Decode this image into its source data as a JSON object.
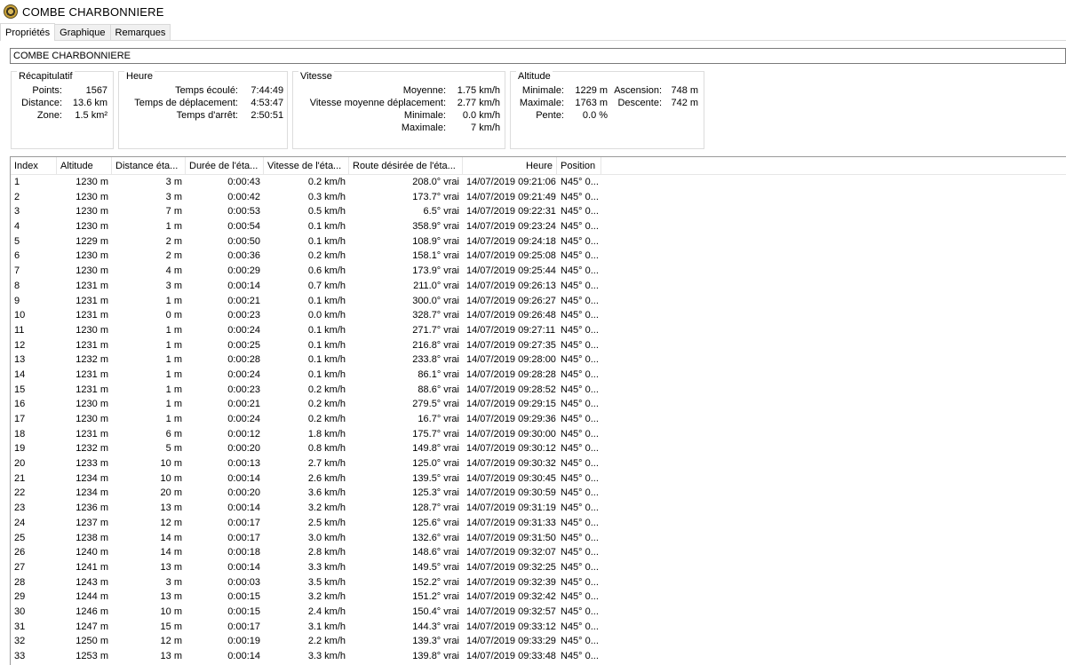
{
  "window": {
    "title": "COMBE  CHARBONNIERE",
    "icon": "app-logo-icon"
  },
  "tabs": [
    {
      "label": "Propriétés",
      "active": true
    },
    {
      "label": "Graphique",
      "active": false
    },
    {
      "label": "Remarques",
      "active": false
    }
  ],
  "name_field": {
    "value": "COMBE  CHARBONNIERE"
  },
  "recap": {
    "title": "Récapitulatif",
    "points_label": "Points:",
    "points_value": "1567",
    "distance_label": "Distance:",
    "distance_value": "13.6 km",
    "zone_label": "Zone:",
    "zone_value": "1.5 km²"
  },
  "heure": {
    "title": "Heure",
    "elapsed_label": "Temps écoulé:",
    "elapsed_value": "7:44:49",
    "moving_label": "Temps de déplacement:",
    "moving_value": "4:53:47",
    "stopped_label": "Temps d'arrêt:",
    "stopped_value": "2:50:51"
  },
  "vitesse": {
    "title": "Vitesse",
    "avg_label": "Moyenne:",
    "avg_value": "1.75 km/h",
    "moving_avg_label": "Vitesse moyenne déplacement:",
    "moving_avg_value": "2.77 km/h",
    "min_label": "Minimale:",
    "min_value": "0.0 km/h",
    "max_label": "Maximale:",
    "max_value": "7 km/h"
  },
  "altitude": {
    "title": "Altitude",
    "min_label": "Minimale:",
    "min_value": "1229 m",
    "max_label": "Maximale:",
    "max_value": "1763 m",
    "slope_label": "Pente:",
    "slope_value": "0.0 %",
    "ascent_label": "Ascension:",
    "ascent_value": "748 m",
    "descent_label": "Descente:",
    "descent_value": "742 m"
  },
  "table": {
    "columns": [
      "Index",
      "Altitude",
      "Distance éta...",
      "Durée de l'éta...",
      "Vitesse de l'éta...",
      "Route désirée de l'éta...",
      "Heure",
      "Position"
    ],
    "rows": [
      [
        "1",
        "1230 m",
        "3 m",
        "0:00:43",
        "0.2 km/h",
        "208.0° vrai",
        "14/07/2019 09:21:06",
        "N45° 0..."
      ],
      [
        "2",
        "1230 m",
        "3 m",
        "0:00:42",
        "0.3 km/h",
        "173.7° vrai",
        "14/07/2019 09:21:49",
        "N45° 0..."
      ],
      [
        "3",
        "1230 m",
        "7 m",
        "0:00:53",
        "0.5 km/h",
        "6.5° vrai",
        "14/07/2019 09:22:31",
        "N45° 0..."
      ],
      [
        "4",
        "1230 m",
        "1 m",
        "0:00:54",
        "0.1 km/h",
        "358.9° vrai",
        "14/07/2019 09:23:24",
        "N45° 0..."
      ],
      [
        "5",
        "1229 m",
        "2 m",
        "0:00:50",
        "0.1 km/h",
        "108.9° vrai",
        "14/07/2019 09:24:18",
        "N45° 0..."
      ],
      [
        "6",
        "1230 m",
        "2 m",
        "0:00:36",
        "0.2 km/h",
        "158.1° vrai",
        "14/07/2019 09:25:08",
        "N45° 0..."
      ],
      [
        "7",
        "1230 m",
        "4 m",
        "0:00:29",
        "0.6 km/h",
        "173.9° vrai",
        "14/07/2019 09:25:44",
        "N45° 0..."
      ],
      [
        "8",
        "1231 m",
        "3 m",
        "0:00:14",
        "0.7 km/h",
        "211.0° vrai",
        "14/07/2019 09:26:13",
        "N45° 0..."
      ],
      [
        "9",
        "1231 m",
        "1 m",
        "0:00:21",
        "0.1 km/h",
        "300.0° vrai",
        "14/07/2019 09:26:27",
        "N45° 0..."
      ],
      [
        "10",
        "1231 m",
        "0 m",
        "0:00:23",
        "0.0 km/h",
        "328.7° vrai",
        "14/07/2019 09:26:48",
        "N45° 0..."
      ],
      [
        "11",
        "1230 m",
        "1 m",
        "0:00:24",
        "0.1 km/h",
        "271.7° vrai",
        "14/07/2019 09:27:11",
        "N45° 0..."
      ],
      [
        "12",
        "1231 m",
        "1 m",
        "0:00:25",
        "0.1 km/h",
        "216.8° vrai",
        "14/07/2019 09:27:35",
        "N45° 0..."
      ],
      [
        "13",
        "1232 m",
        "1 m",
        "0:00:28",
        "0.1 km/h",
        "233.8° vrai",
        "14/07/2019 09:28:00",
        "N45° 0..."
      ],
      [
        "14",
        "1231 m",
        "1 m",
        "0:00:24",
        "0.1 km/h",
        "86.1° vrai",
        "14/07/2019 09:28:28",
        "N45° 0..."
      ],
      [
        "15",
        "1231 m",
        "1 m",
        "0:00:23",
        "0.2 km/h",
        "88.6° vrai",
        "14/07/2019 09:28:52",
        "N45° 0..."
      ],
      [
        "16",
        "1230 m",
        "1 m",
        "0:00:21",
        "0.2 km/h",
        "279.5° vrai",
        "14/07/2019 09:29:15",
        "N45° 0..."
      ],
      [
        "17",
        "1230 m",
        "1 m",
        "0:00:24",
        "0.2 km/h",
        "16.7° vrai",
        "14/07/2019 09:29:36",
        "N45° 0..."
      ],
      [
        "18",
        "1231 m",
        "6 m",
        "0:00:12",
        "1.8 km/h",
        "175.7° vrai",
        "14/07/2019 09:30:00",
        "N45° 0..."
      ],
      [
        "19",
        "1232 m",
        "5 m",
        "0:00:20",
        "0.8 km/h",
        "149.8° vrai",
        "14/07/2019 09:30:12",
        "N45° 0..."
      ],
      [
        "20",
        "1233 m",
        "10 m",
        "0:00:13",
        "2.7 km/h",
        "125.0° vrai",
        "14/07/2019 09:30:32",
        "N45° 0..."
      ],
      [
        "21",
        "1234 m",
        "10 m",
        "0:00:14",
        "2.6 km/h",
        "139.5° vrai",
        "14/07/2019 09:30:45",
        "N45° 0..."
      ],
      [
        "22",
        "1234 m",
        "20 m",
        "0:00:20",
        "3.6 km/h",
        "125.3° vrai",
        "14/07/2019 09:30:59",
        "N45° 0..."
      ],
      [
        "23",
        "1236 m",
        "13 m",
        "0:00:14",
        "3.2 km/h",
        "128.7° vrai",
        "14/07/2019 09:31:19",
        "N45° 0..."
      ],
      [
        "24",
        "1237 m",
        "12 m",
        "0:00:17",
        "2.5 km/h",
        "125.6° vrai",
        "14/07/2019 09:31:33",
        "N45° 0..."
      ],
      [
        "25",
        "1238 m",
        "14 m",
        "0:00:17",
        "3.0 km/h",
        "132.6° vrai",
        "14/07/2019 09:31:50",
        "N45° 0..."
      ],
      [
        "26",
        "1240 m",
        "14 m",
        "0:00:18",
        "2.8 km/h",
        "148.6° vrai",
        "14/07/2019 09:32:07",
        "N45° 0..."
      ],
      [
        "27",
        "1241 m",
        "13 m",
        "0:00:14",
        "3.3 km/h",
        "149.5° vrai",
        "14/07/2019 09:32:25",
        "N45° 0..."
      ],
      [
        "28",
        "1243 m",
        "3 m",
        "0:00:03",
        "3.5 km/h",
        "152.2° vrai",
        "14/07/2019 09:32:39",
        "N45° 0..."
      ],
      [
        "29",
        "1244 m",
        "13 m",
        "0:00:15",
        "3.2 km/h",
        "151.2° vrai",
        "14/07/2019 09:32:42",
        "N45° 0..."
      ],
      [
        "30",
        "1246 m",
        "10 m",
        "0:00:15",
        "2.4 km/h",
        "150.4° vrai",
        "14/07/2019 09:32:57",
        "N45° 0..."
      ],
      [
        "31",
        "1247 m",
        "15 m",
        "0:00:17",
        "3.1 km/h",
        "144.3° vrai",
        "14/07/2019 09:33:12",
        "N45° 0..."
      ],
      [
        "32",
        "1250 m",
        "12 m",
        "0:00:19",
        "2.2 km/h",
        "139.3° vrai",
        "14/07/2019 09:33:29",
        "N45° 0..."
      ],
      [
        "33",
        "1253 m",
        "13 m",
        "0:00:14",
        "3.3 km/h",
        "139.8° vrai",
        "14/07/2019 09:33:48",
        "N45° 0..."
      ]
    ]
  }
}
